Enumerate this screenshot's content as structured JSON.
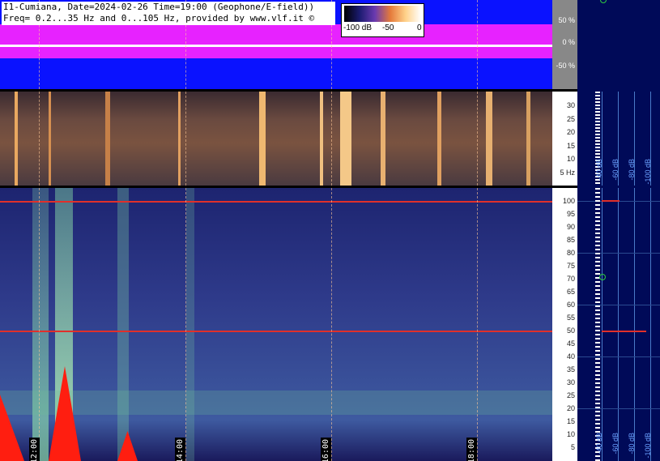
{
  "header": {
    "line1": "I1-Cumiana, Date=2024-02-26 Time=19:00 (Geophone/E-field))",
    "line2": "Freq= 0.2...35 Hz and 0...105 Hz, provided by www.vlf.it ©"
  },
  "color_scale": {
    "labels": [
      "-100 dB",
      "-50",
      "0"
    ]
  },
  "waveform_scale": [
    "50 %",
    "0 %",
    "-50 %"
  ],
  "upper_freq_ticks": [
    "30",
    "25",
    "20",
    "15",
    "10",
    "5 Hz"
  ],
  "lower_freq_ticks": [
    "100",
    "95",
    "90",
    "85",
    "80",
    "75",
    "70",
    "65",
    "60",
    "55",
    "50",
    "45",
    "40",
    "35",
    "30",
    "25",
    "20",
    "15",
    "10",
    "5"
  ],
  "time_labels": [
    "12:00",
    "14:00",
    "16:00",
    "18:00"
  ],
  "sidebar": {
    "db_labels": [
      "-40 dB",
      "-60 dB",
      "-80 dB",
      "-100 dB"
    ]
  },
  "colors": {
    "waveform_bg": "#0a12ff",
    "waveform_signal": "#ff25ff",
    "lower_spectrogram": "#2e3a8a",
    "upper_spectrogram": "#7a5340",
    "line_50hz": "#e0302a",
    "sidebar_bg": "#000a58"
  }
}
